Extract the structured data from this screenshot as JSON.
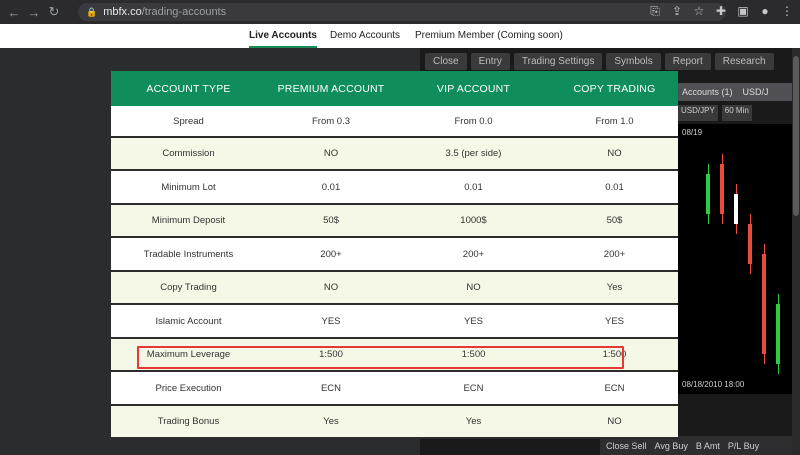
{
  "browser": {
    "url_host": "mbfx.co",
    "url_path": "/trading-accounts"
  },
  "tabs": [
    {
      "label": "Live Accounts",
      "active": true
    },
    {
      "label": "Demo Accounts",
      "active": false
    },
    {
      "label": "Premium Member (Coming soon)",
      "active": false
    }
  ],
  "background": {
    "tabs": [
      "Close",
      "Entry",
      "Trading Settings",
      "Symbols",
      "Report",
      "Research"
    ],
    "accounts_label": "Accounts (1)",
    "pair_label": "USD/J",
    "symbol": "USD/JPY",
    "timeframe": "60 Min",
    "date_top": "08/19",
    "date_bottom": "08/18/2010 18:00",
    "bottom_labels": [
      "Close Sell",
      "Avg Buy",
      "B Amt",
      "P/L Buy"
    ]
  },
  "table": {
    "headers": [
      "ACCOUNT TYPE",
      "PREMIUM ACCOUNT",
      "VIP ACCOUNT",
      "COPY TRADING"
    ],
    "rows": [
      {
        "label": "Spread",
        "premium": "From 0.3",
        "vip": "From 0.0",
        "copy": "From 1.0"
      },
      {
        "label": "Commission",
        "premium": "NO",
        "vip": "3.5 (per side)",
        "copy": "NO"
      },
      {
        "label": "Minimum Lot",
        "premium": "0.01",
        "vip": "0.01",
        "copy": "0.01"
      },
      {
        "label": "Minimum Deposit",
        "premium": "50$",
        "vip": "1000$",
        "copy": "50$"
      },
      {
        "label": "Tradable Instruments",
        "premium": "200+",
        "vip": "200+",
        "copy": "200+"
      },
      {
        "label": "Copy Trading",
        "premium": "NO",
        "vip": "NO",
        "copy": "Yes"
      },
      {
        "label": "Islamic Account",
        "premium": "YES",
        "vip": "YES",
        "copy": "YES"
      },
      {
        "label": "Maximum Leverage",
        "premium": "1:500",
        "vip": "1:500",
        "copy": "1:500"
      },
      {
        "label": "Price Execution",
        "premium": "ECN",
        "vip": "ECN",
        "copy": "ECN"
      },
      {
        "label": "Trading Bonus",
        "premium": "Yes",
        "vip": "Yes",
        "copy": "NO"
      }
    ]
  },
  "colors": {
    "header_green": "#0f8e5b",
    "highlight_red": "#e53935",
    "row_tint": "#f5f8e6"
  }
}
